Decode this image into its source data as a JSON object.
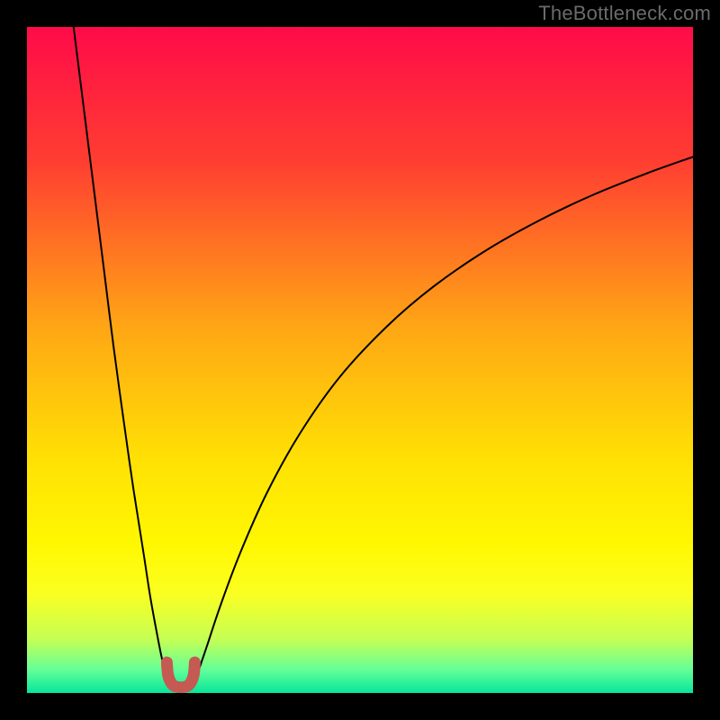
{
  "watermark": "TheBottleneck.com",
  "chart_data": {
    "type": "line",
    "title": "",
    "xlabel": "",
    "ylabel": "",
    "xlim": [
      0,
      100
    ],
    "ylim": [
      0,
      100
    ],
    "grid": false,
    "legend": false,
    "background_gradient": {
      "stops": [
        {
          "offset": 0.0,
          "color": "#ff0b49"
        },
        {
          "offset": 0.2,
          "color": "#ff3d31"
        },
        {
          "offset": 0.45,
          "color": "#ffa615"
        },
        {
          "offset": 0.65,
          "color": "#ffe104"
        },
        {
          "offset": 0.78,
          "color": "#fff802"
        },
        {
          "offset": 0.85,
          "color": "#fbff20"
        },
        {
          "offset": 0.92,
          "color": "#c4ff55"
        },
        {
          "offset": 0.965,
          "color": "#64ff97"
        },
        {
          "offset": 1.0,
          "color": "#06e69b"
        }
      ]
    },
    "series": [
      {
        "name": "bottleneck-curve-left",
        "color": "#000000",
        "width": 2,
        "x": [
          7.0,
          8.5,
          10.0,
          11.5,
          13.0,
          14.5,
          16.0,
          17.5,
          18.5,
          19.5,
          20.3,
          21.0,
          21.4,
          21.8
        ],
        "y": [
          100.0,
          88.0,
          76.0,
          64.0,
          52.0,
          41.0,
          30.5,
          21.0,
          14.5,
          9.0,
          5.0,
          2.5,
          1.3,
          0.9
        ]
      },
      {
        "name": "bottleneck-curve-right",
        "color": "#000000",
        "width": 2,
        "x": [
          24.2,
          24.8,
          25.6,
          27.0,
          29.0,
          32.0,
          36.0,
          41.0,
          47.0,
          54.0,
          61.0,
          69.0,
          77.0,
          85.0,
          93.0,
          100.0
        ],
        "y": [
          0.9,
          1.5,
          3.0,
          7.0,
          13.0,
          21.0,
          30.0,
          39.0,
          47.5,
          55.0,
          61.0,
          66.5,
          71.0,
          74.8,
          78.0,
          80.5
        ]
      },
      {
        "name": "bottleneck-marker",
        "shape": "u-marker",
        "color": "#c55a52",
        "width": 13,
        "x": [
          21.0,
          21.2,
          21.8,
          22.6,
          23.6,
          24.4,
          25.0,
          25.2
        ],
        "y": [
          4.6,
          2.6,
          1.3,
          0.9,
          0.9,
          1.3,
          2.6,
          4.6
        ]
      }
    ],
    "annotations": []
  }
}
